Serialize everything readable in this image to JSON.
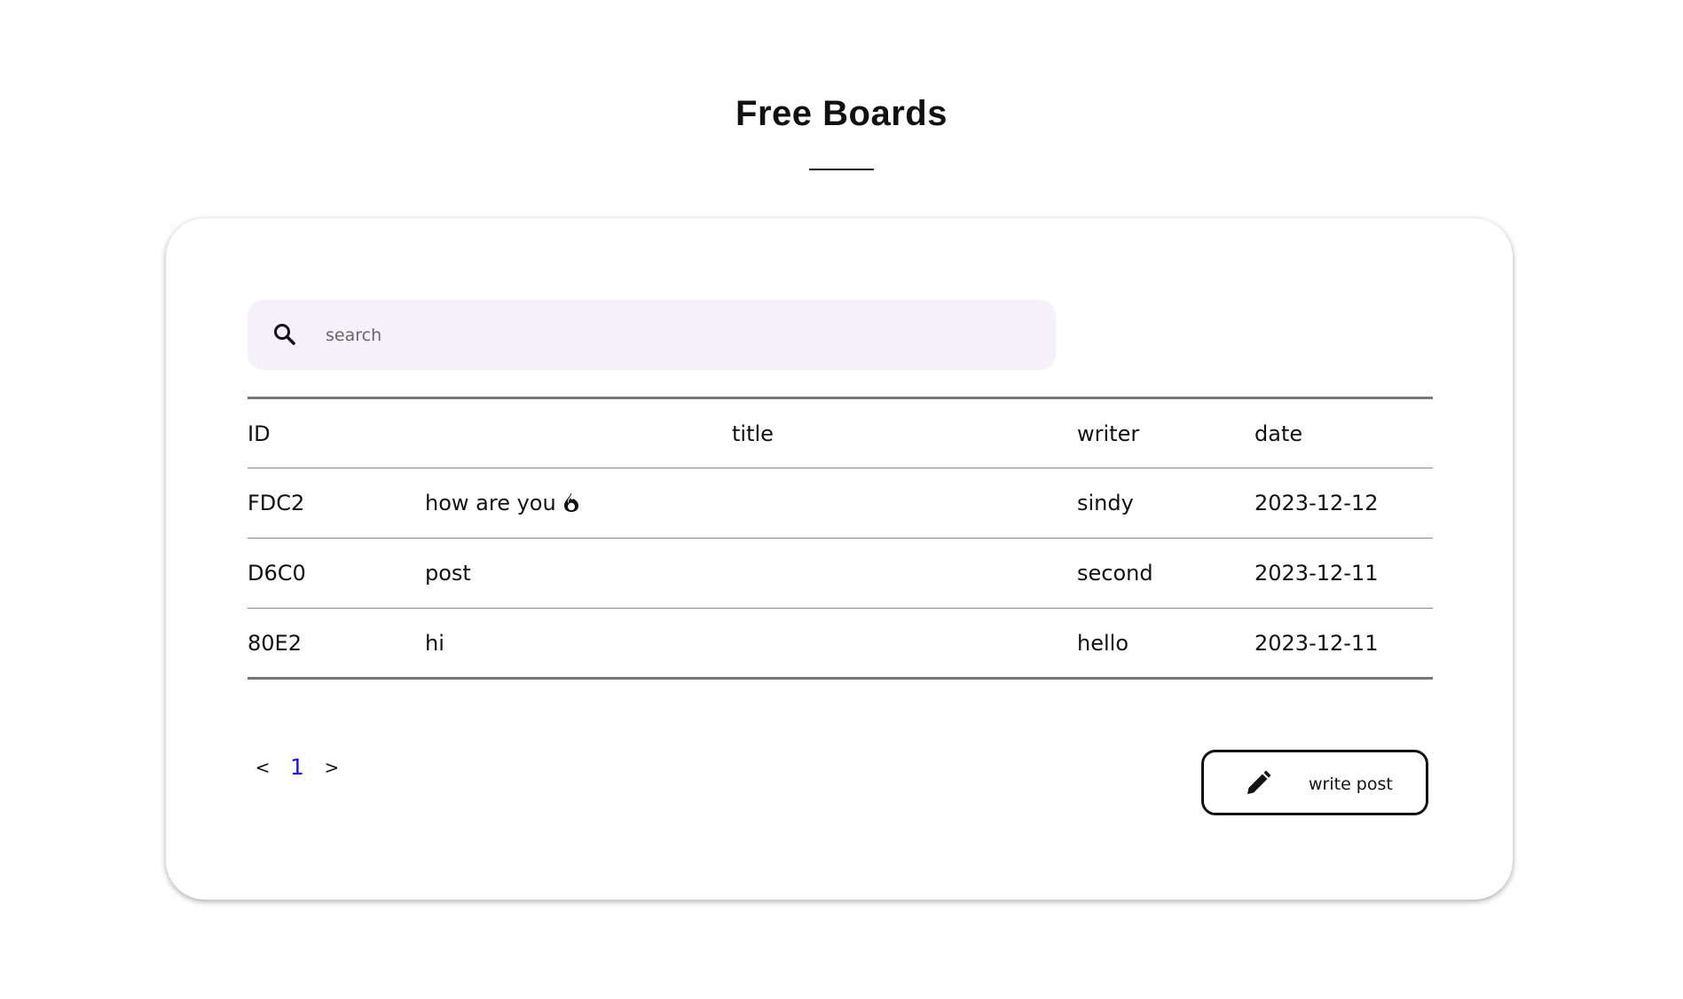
{
  "header": {
    "title": "Free Boards"
  },
  "search": {
    "placeholder": "search",
    "value": ""
  },
  "table": {
    "columns": [
      "ID",
      "title",
      "writer",
      "date"
    ],
    "rows": [
      {
        "id": "FDC2",
        "title": "how are you",
        "hot": true,
        "writer": "sindy",
        "date": "2023-12-12"
      },
      {
        "id": "D6C0",
        "title": "post",
        "hot": false,
        "writer": "second",
        "date": "2023-12-11"
      },
      {
        "id": "80E2",
        "title": "hi",
        "hot": false,
        "writer": "hello",
        "date": "2023-12-11"
      }
    ]
  },
  "pagination": {
    "prev": "<",
    "current": "1",
    "next": ">"
  },
  "actions": {
    "write_label": "write post"
  },
  "icons": {
    "search": "search-icon",
    "hot": "fire-icon",
    "write": "pencil-icon"
  },
  "colors": {
    "search_bg": "#f4f1fb",
    "page_active": "#1a14d8"
  }
}
